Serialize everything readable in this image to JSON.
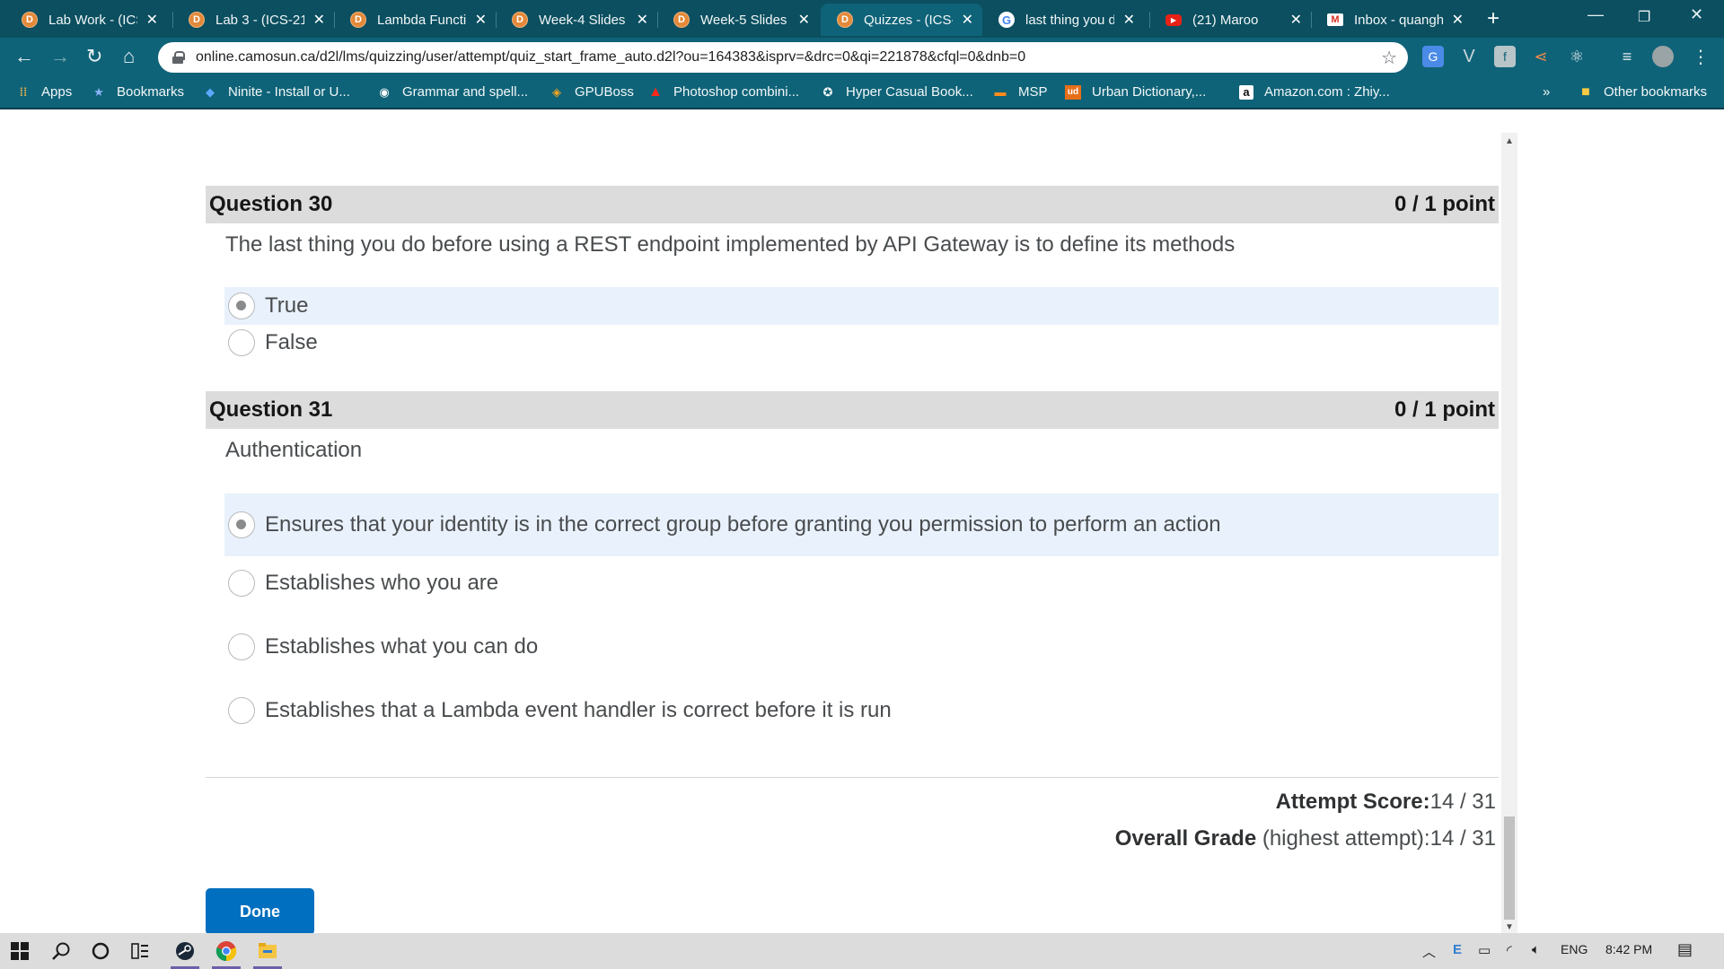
{
  "browser": {
    "tabs": [
      {
        "title": "Lab Work - (ICS",
        "icon": "brightspace-icon",
        "active": false
      },
      {
        "title": "Lab 3 - (ICS-21",
        "icon": "brightspace-icon",
        "active": false
      },
      {
        "title": "Lambda Functio",
        "icon": "brightspace-icon",
        "active": false
      },
      {
        "title": "Week-4 Slides",
        "icon": "brightspace-icon",
        "active": false
      },
      {
        "title": "Week-5 Slides",
        "icon": "brightspace-icon",
        "active": false
      },
      {
        "title": "Quizzes - (ICS-",
        "icon": "brightspace-icon",
        "active": true
      },
      {
        "title": "last thing you d",
        "icon": "google-icon",
        "active": false
      },
      {
        "title": "(21) Maroo",
        "icon": "youtube-icon",
        "active": false
      },
      {
        "title": "Inbox - quangh",
        "icon": "gmail-icon",
        "active": false
      }
    ],
    "url": "online.camosun.ca/d2l/lms/quizzing/user/attempt/quiz_start_frame_auto.d2l?ou=164383&isprv=&drc=0&qi=221878&cfql=0&dnb=0",
    "bookmarks": [
      {
        "label": "Apps",
        "icon": "apps-grid-icon"
      },
      {
        "label": "Bookmarks",
        "icon": "star-icon"
      },
      {
        "label": "Ninite - Install or U...",
        "icon": "ninite-icon"
      },
      {
        "label": "Grammar and spell...",
        "icon": "grammarly-icon"
      },
      {
        "label": "GPUBoss",
        "icon": "gpuboss-icon"
      },
      {
        "label": "Photoshop combini...",
        "icon": "adobe-icon"
      },
      {
        "label": "Hyper Casual Book...",
        "icon": "hyper-casual-icon"
      },
      {
        "label": "MSP",
        "icon": "msp-icon"
      },
      {
        "label": "Urban Dictionary,...",
        "icon": "urban-dictionary-icon"
      },
      {
        "label": "Amazon.com : Zhiy...",
        "icon": "amazon-icon"
      }
    ],
    "overflow": "»",
    "other_bookmarks": "Other bookmarks"
  },
  "quiz": {
    "questions": [
      {
        "title": "Question 30",
        "points": "0 / 1 point",
        "text": "The last thing you do before using a REST endpoint implemented by API Gateway is to define its methods",
        "options": [
          {
            "label": "True",
            "selected": true
          },
          {
            "label": "False",
            "selected": false
          }
        ]
      },
      {
        "title": "Question 31",
        "points": "0 / 1 point",
        "text": "Authentication",
        "options": [
          {
            "label": "Ensures that your identity is in the correct group before granting you permission to perform an action",
            "selected": true
          },
          {
            "label": "Establishes who you are",
            "selected": false
          },
          {
            "label": "Establishes what you can do",
            "selected": false
          },
          {
            "label": "Establishes that a Lambda event handler is correct before it is run",
            "selected": false
          }
        ]
      }
    ],
    "attempt_score_label": "Attempt Score:",
    "attempt_score_value": "14 / 31",
    "overall_grade_label": "Overall Grade",
    "overall_grade_note": " (highest attempt):",
    "overall_grade_value": "14 / 31",
    "done_label": "Done"
  },
  "taskbar": {
    "tray_language": "ENG",
    "clock": "8:42 PM"
  }
}
